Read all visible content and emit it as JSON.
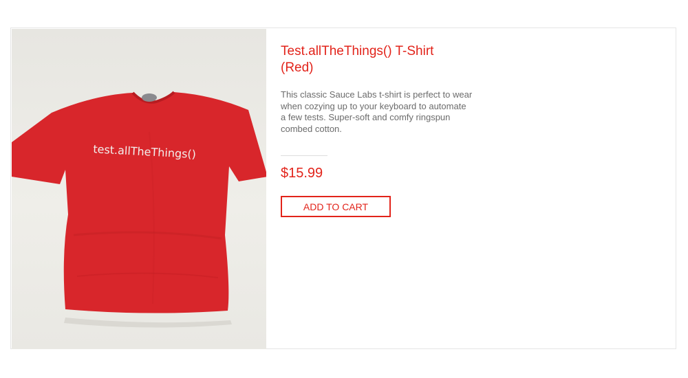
{
  "product": {
    "title": "Test.allTheThings() T-Shirt (Red)",
    "description": "This classic Sauce Labs t-shirt is perfect to wear when cozying up to your keyboard to automate a few tests. Super-soft and comfy ringspun combed cotton.",
    "price": "$15.99",
    "add_to_cart_label": "ADD TO CART",
    "shirt_print_text": "test.allTheThings()",
    "shirt_color": "#d8262b",
    "accent_color": "#e2231a"
  }
}
